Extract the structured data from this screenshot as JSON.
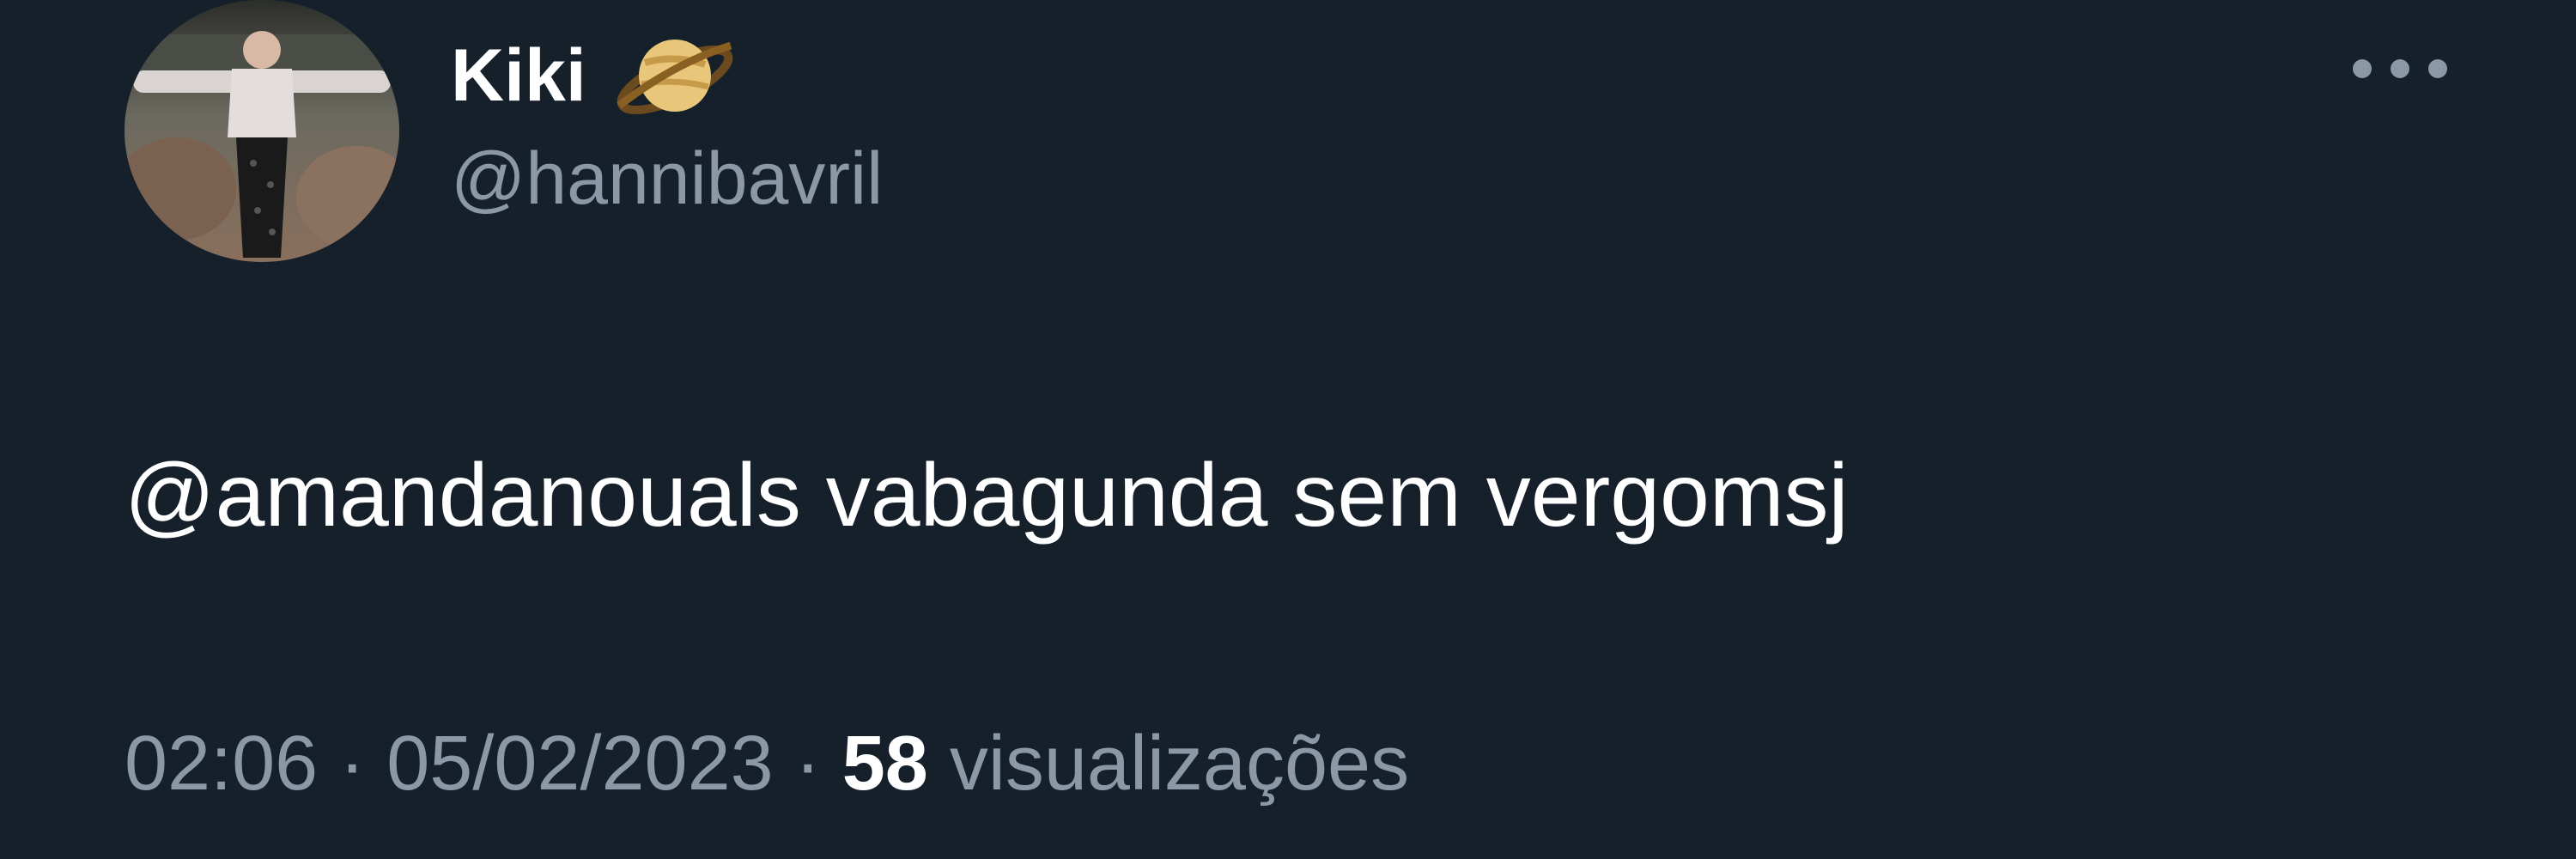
{
  "tweet": {
    "display_name": "Kiki",
    "name_emoji_icon": "ringed-planet-icon",
    "handle": "@hannibavril",
    "text": "@amandanouals vabagunda sem vergomsj",
    "time": "02:06",
    "date": "05/02/2023",
    "separator": "·",
    "views_count": "58",
    "views_label": "visualizações"
  },
  "colors": {
    "background": "#15202b",
    "primary_text": "#ffffff",
    "secondary_text": "#8b98a5"
  }
}
